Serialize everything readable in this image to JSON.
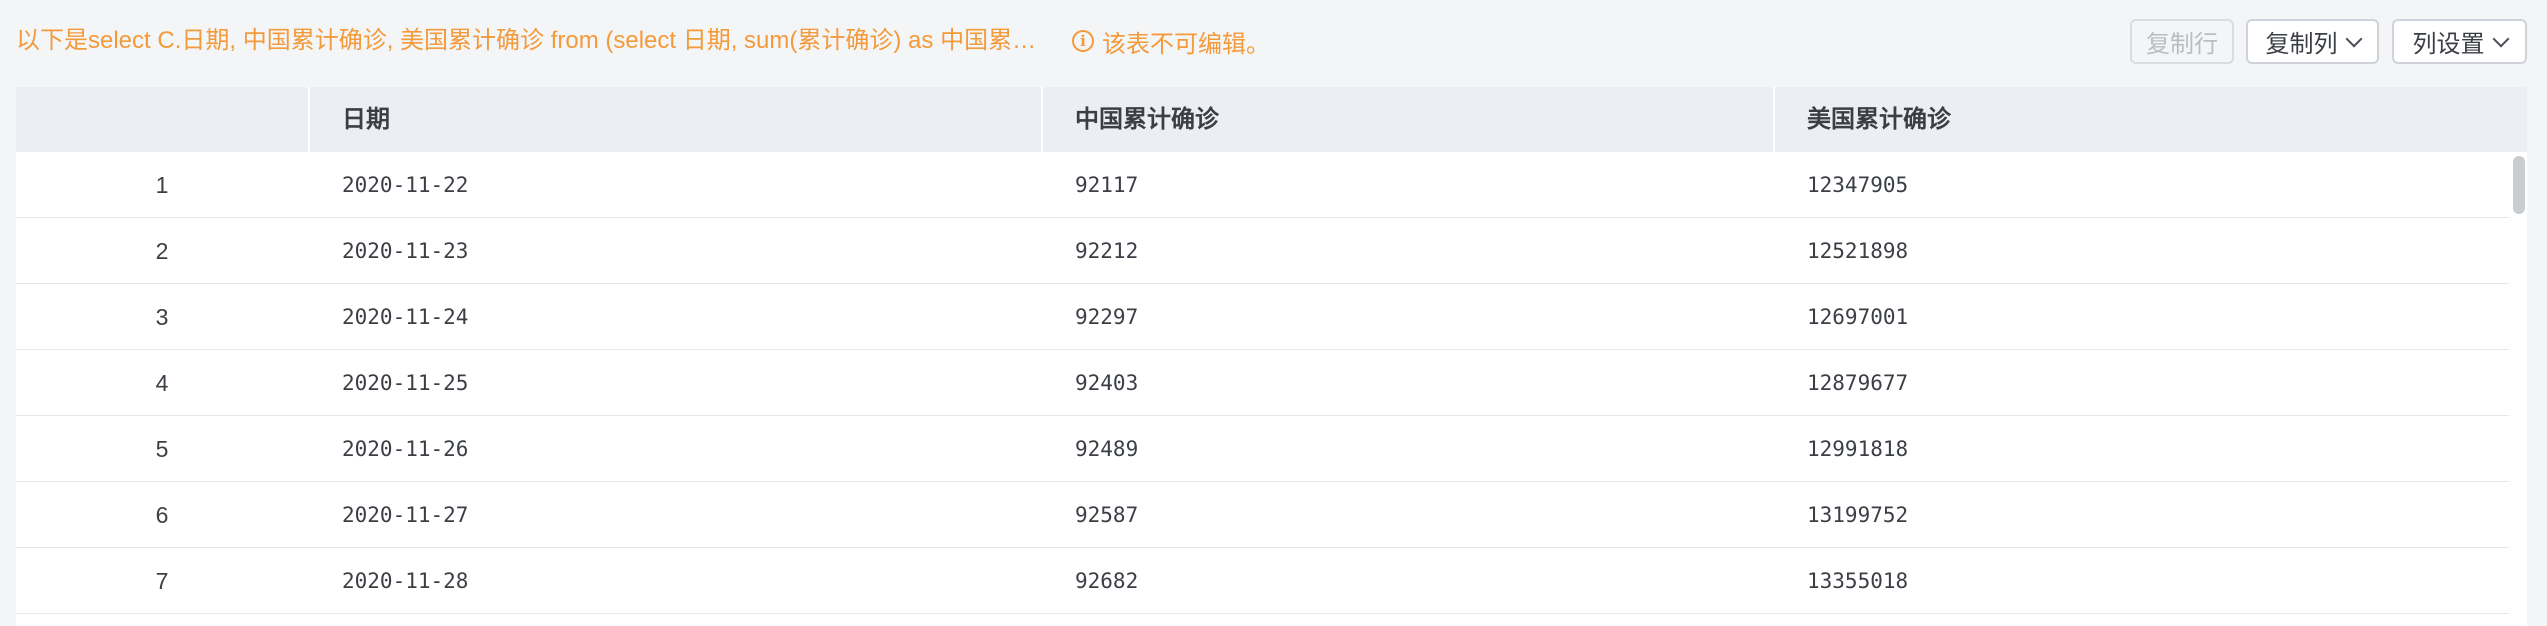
{
  "toolbar": {
    "sql_message": "以下是select C.日期, 中国累计确诊, 美国累计确诊 from (select 日期, sum(累计确诊) as 中国累计确诊 from 疫情数据 where 国家='中国' group by 日期) C",
    "readonly_note": "该表不可编辑。",
    "copy_row_label": "复制行",
    "copy_col_label": "复制列",
    "col_settings_label": "列设置"
  },
  "table": {
    "columns": [
      "",
      "日期",
      "中国累计确诊",
      "美国累计确诊"
    ],
    "rows": [
      {
        "idx": "1",
        "date": "2020-11-22",
        "china": "92117",
        "usa": "12347905"
      },
      {
        "idx": "2",
        "date": "2020-11-23",
        "china": "92212",
        "usa": "12521898"
      },
      {
        "idx": "3",
        "date": "2020-11-24",
        "china": "92297",
        "usa": "12697001"
      },
      {
        "idx": "4",
        "date": "2020-11-25",
        "china": "92403",
        "usa": "12879677"
      },
      {
        "idx": "5",
        "date": "2020-11-26",
        "china": "92489",
        "usa": "12991818"
      },
      {
        "idx": "6",
        "date": "2020-11-27",
        "china": "92587",
        "usa": "13199752"
      },
      {
        "idx": "7",
        "date": "2020-11-28",
        "china": "92682",
        "usa": "13355018"
      }
    ]
  },
  "colors": {
    "warning_text": "#f39a3b",
    "header_bg": "#ebeef2",
    "page_bg": "#f4f5f7"
  },
  "icons": {
    "readonly": "info-icon",
    "dropdown": "chevron-down-icon"
  }
}
